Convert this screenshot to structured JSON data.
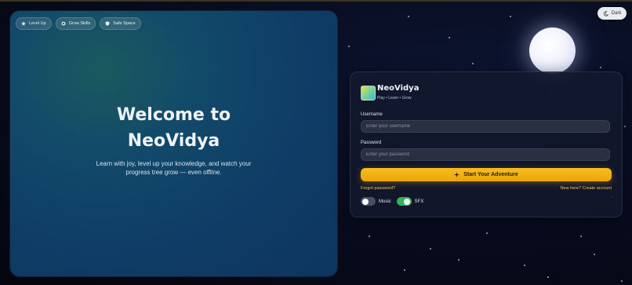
{
  "hero": {
    "chips": [
      {
        "icon": "star-icon",
        "label": "Level Up"
      },
      {
        "icon": "sprout-icon",
        "label": "Grow Skills"
      },
      {
        "icon": "shield-icon",
        "label": "Safe Space"
      }
    ],
    "title_line1": "Welcome to",
    "title_line2": "NeoVidya",
    "subtitle_line1": "Learn with joy, level up your knowledge, and watch your",
    "subtitle_line2": "progress tree grow — even offline."
  },
  "theme_toggle": {
    "icon": "moon-icon",
    "label": "Dark"
  },
  "login": {
    "brand": "NeoVidya",
    "tagline": "Play • Learn • Grow",
    "username_label": "Username",
    "username_placeholder": "Enter your username",
    "password_label": "Password",
    "password_placeholder": "Enter your password",
    "submit_label": "Start Your Adventure",
    "forgot_link": "Forgot password?",
    "create_link": "New here? Create account",
    "music_label": "Music",
    "music_on": false,
    "sfx_label": "SFX",
    "sfx_on": true
  },
  "colors": {
    "accent": "#f5b81a",
    "toggle_on": "#2fb35a",
    "background": "#070b1c"
  }
}
